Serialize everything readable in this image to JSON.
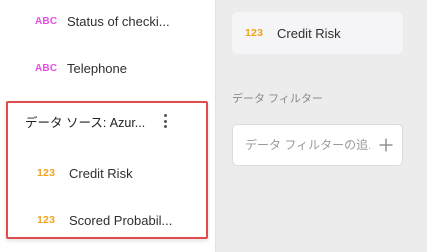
{
  "fields_panel": {
    "items": [
      {
        "type": "ABC",
        "label": "Status of checki..."
      },
      {
        "type": "ABC",
        "label": "Telephone"
      }
    ],
    "data_source": {
      "title": "データ ソース: Azur...",
      "items": [
        {
          "type": "123",
          "label": "Credit Risk"
        },
        {
          "type": "123",
          "label": "Scored Probabil..."
        }
      ]
    }
  },
  "right_panel": {
    "selected_field": {
      "type": "123",
      "label": "Credit Risk"
    },
    "filter_section_label": "データ フィルター",
    "filter_input_placeholder": "データ フィルターの追..."
  },
  "colors": {
    "text_type": "#e64ee6",
    "numeric_type": "#f2a218",
    "highlight_border": "#e24b4b"
  },
  "icons": {
    "more": "kebab-menu-icon",
    "add": "plus-icon"
  }
}
